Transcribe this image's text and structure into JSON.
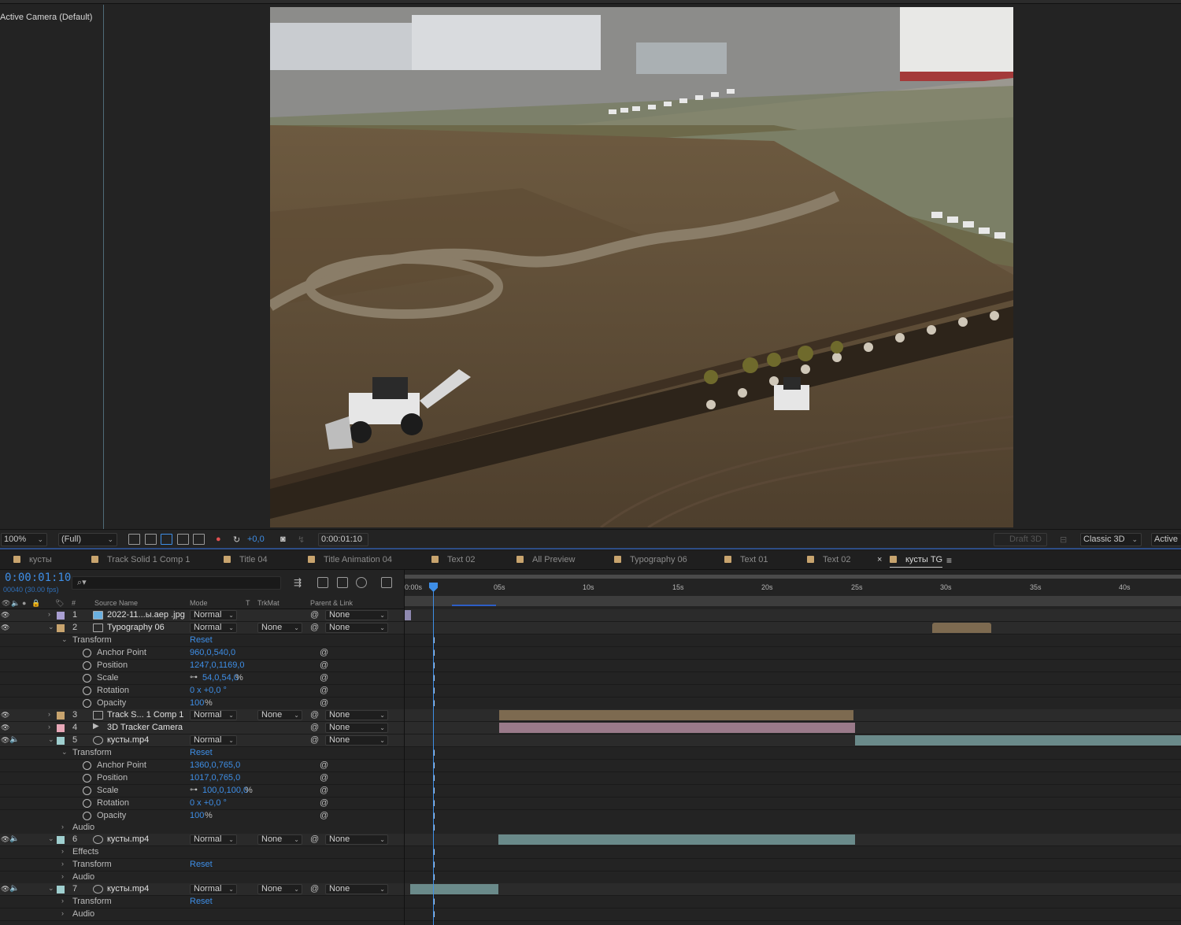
{
  "viewer": {
    "camera_label": "Active Camera (Default)"
  },
  "viewer_toolbar": {
    "zoom": "100%",
    "resolution": "(Full)",
    "exposure": "+0,0",
    "current_time": "0:00:01:10",
    "draft3d": "Draft 3D",
    "renderer": "Classic 3D",
    "view": "Active"
  },
  "tabs": [
    {
      "label": "кусты",
      "color": "#c8a46e"
    },
    {
      "label": "Track Solid 1 Comp 1",
      "color": "#c8a46e"
    },
    {
      "label": "Title 04",
      "color": "#c8a46e"
    },
    {
      "label": "Title Animation 04",
      "color": "#c8a46e"
    },
    {
      "label": "Text 02",
      "color": "#c8a46e"
    },
    {
      "label": "All Preview",
      "color": "#c8a46e"
    },
    {
      "label": "Typography 06",
      "color": "#c8a46e"
    },
    {
      "label": "Text 01",
      "color": "#c8a46e"
    },
    {
      "label": "Text 02",
      "color": "#c8a46e"
    },
    {
      "label": "кусты TG",
      "color": "#c8a46e",
      "active": true
    }
  ],
  "timeline": {
    "timecode": "0:00:01:10",
    "frames_fps": "00040 (30.00 fps)",
    "search_placeholder": "⌕▾",
    "columns": {
      "source_name": "Source Name",
      "mode": "Mode",
      "t": "T",
      "trkmat": "TrkMat",
      "parent": "Parent & Link",
      "num": "#"
    },
    "ruler": [
      "0:00s",
      "05s",
      "10s",
      "15s",
      "20s",
      "25s",
      "30s",
      "35s",
      "40s"
    ],
    "layers": [
      {
        "num": "1",
        "name": "2022-11...ы.aep .jpg",
        "mode": "Normal",
        "trkmat": "",
        "parent": "None",
        "color": "#a99fd2"
      },
      {
        "num": "2",
        "name": "Typography 06",
        "mode": "Normal",
        "trkmat": "None",
        "parent": "None",
        "color": "#c8a46e"
      },
      {
        "num": "3",
        "name": "Track S... 1 Comp 1",
        "mode": "Normal",
        "trkmat": "None",
        "parent": "None",
        "color": "#c8a46e"
      },
      {
        "num": "4",
        "name": "3D Tracker Camera",
        "mode": "",
        "trkmat": "",
        "parent": "None",
        "color": "#e8a8b8"
      },
      {
        "num": "5",
        "name": "кусты.mp4",
        "mode": "Normal",
        "trkmat": "",
        "parent": "None",
        "color": "#9fcfcf"
      },
      {
        "num": "6",
        "name": "кусты.mp4",
        "mode": "Normal",
        "trkmat": "None",
        "parent": "None",
        "color": "#9fcfcf"
      },
      {
        "num": "7",
        "name": "кусты.mp4",
        "mode": "Normal",
        "trkmat": "None",
        "parent": "None",
        "color": "#9fcfcf"
      }
    ],
    "props": {
      "transform": "Transform",
      "reset": "Reset",
      "anchor": "Anchor Point",
      "position": "Position",
      "scale": "Scale",
      "rotation": "Rotation",
      "opacity": "Opacity",
      "audio": "Audio",
      "effects": "Effects"
    },
    "layer2_values": {
      "anchor": "960,0,540,0",
      "position": "1247,0,1169,0",
      "scale": "54,0,54,0",
      "scale_unit": "%",
      "rotation": "0 x +0,0 °",
      "opacity": "100",
      "opacity_unit": "%"
    },
    "layer5_values": {
      "anchor": "1360,0,765,0",
      "position": "1017,0,765,0",
      "scale": "100,0,100,0",
      "scale_unit": "%",
      "rotation": "0 x +0,0 °",
      "opacity": "100",
      "opacity_unit": "%"
    }
  }
}
